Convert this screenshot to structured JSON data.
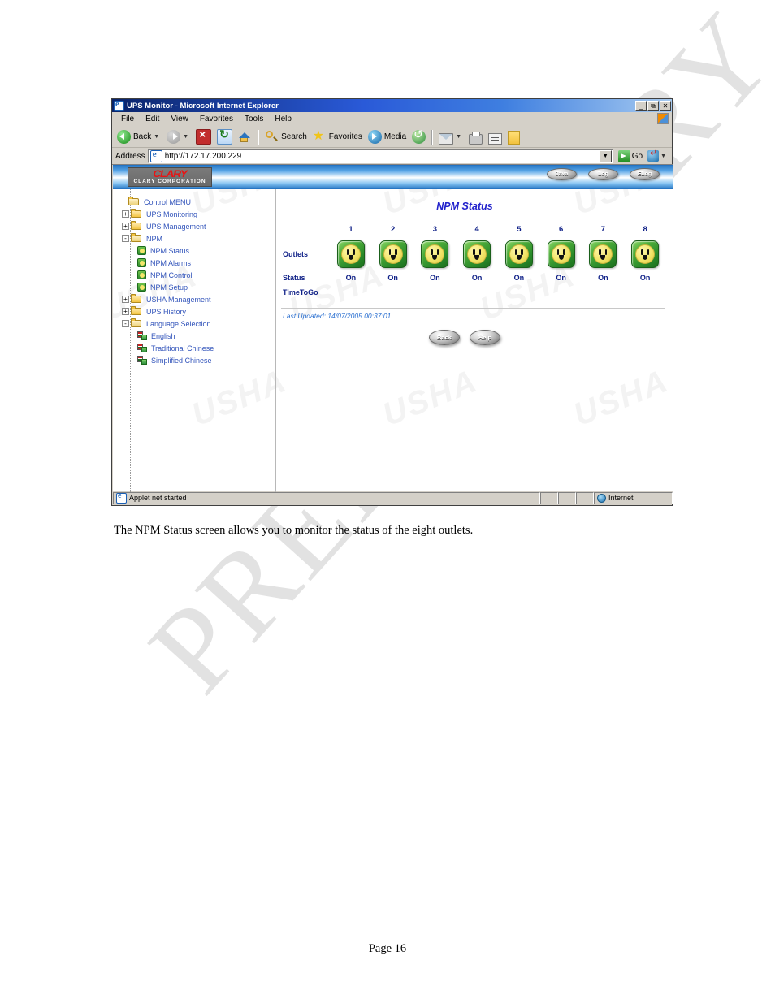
{
  "document": {
    "caption": "The NPM Status screen allows you to monitor the status of the eight outlets.",
    "page_footer": "Page 16",
    "watermark": "PRELIMINARY"
  },
  "browser": {
    "title": "UPS Monitor - Microsoft Internet Explorer",
    "window_buttons": {
      "minimize": "_",
      "restore": "❐",
      "close": "✕"
    },
    "menu": [
      "File",
      "Edit",
      "View",
      "Favorites",
      "Tools",
      "Help"
    ],
    "toolbar": {
      "back": "Back",
      "forward": "",
      "stop": "",
      "refresh": "",
      "home": "",
      "search": "Search",
      "favorites": "Favorites",
      "media": "Media",
      "history": "",
      "mail": "",
      "print": "",
      "edit": "",
      "notes": ""
    },
    "address": {
      "label": "Address",
      "url": "http://172.17.200.229",
      "go": "Go",
      "links": ""
    },
    "status": {
      "message": "Applet net started",
      "zone": "Internet"
    }
  },
  "site": {
    "logo_main": "CLARY",
    "logo_sub": "CLARY CORPORATION",
    "banner_buttons": [
      {
        "label": "Java"
      },
      {
        "label": "Log"
      },
      {
        "label": "ELog"
      }
    ],
    "background_watermark": "USHA"
  },
  "tree": {
    "items": [
      {
        "label": "Control MENU",
        "level": 0,
        "toggle": "",
        "icon": "folder-open"
      },
      {
        "label": "UPS Monitoring",
        "level": 1,
        "toggle": "+",
        "icon": "folder"
      },
      {
        "label": "UPS Management",
        "level": 1,
        "toggle": "+",
        "icon": "folder"
      },
      {
        "label": "NPM",
        "level": 1,
        "toggle": "-",
        "icon": "folder-open"
      },
      {
        "label": "NPM Status",
        "level": 2,
        "toggle": "",
        "icon": "outlet"
      },
      {
        "label": "NPM Alarms",
        "level": 2,
        "toggle": "",
        "icon": "outlet"
      },
      {
        "label": "NPM Control",
        "level": 2,
        "toggle": "",
        "icon": "outlet"
      },
      {
        "label": "NPM Setup",
        "level": 2,
        "toggle": "",
        "icon": "outlet"
      },
      {
        "label": "USHA Management",
        "level": 1,
        "toggle": "+",
        "icon": "folder"
      },
      {
        "label": "UPS History",
        "level": 1,
        "toggle": "+",
        "icon": "folder"
      },
      {
        "label": "Language Selection",
        "level": 1,
        "toggle": "-",
        "icon": "folder-open"
      },
      {
        "label": "English",
        "level": 2,
        "toggle": "",
        "icon": "flag"
      },
      {
        "label": "Traditional Chinese",
        "level": 2,
        "toggle": "",
        "icon": "flag"
      },
      {
        "label": "Simplified Chinese",
        "level": 2,
        "toggle": "",
        "icon": "flag"
      }
    ]
  },
  "npm_status": {
    "title": "NPM Status",
    "row_labels": {
      "outlets": "Outlets",
      "status": "Status",
      "timetogo": "TimeToGo"
    },
    "outlets": [
      {
        "number": "1",
        "status": "On",
        "timetogo": ""
      },
      {
        "number": "2",
        "status": "On",
        "timetogo": ""
      },
      {
        "number": "3",
        "status": "On",
        "timetogo": ""
      },
      {
        "number": "4",
        "status": "On",
        "timetogo": ""
      },
      {
        "number": "5",
        "status": "On",
        "timetogo": ""
      },
      {
        "number": "6",
        "status": "On",
        "timetogo": ""
      },
      {
        "number": "7",
        "status": "On",
        "timetogo": ""
      },
      {
        "number": "8",
        "status": "On",
        "timetogo": ""
      }
    ],
    "last_updated": "Last Updated: 14/07/2005 00:37:01",
    "buttons": [
      {
        "label": "Back"
      },
      {
        "label": "Help"
      }
    ]
  }
}
